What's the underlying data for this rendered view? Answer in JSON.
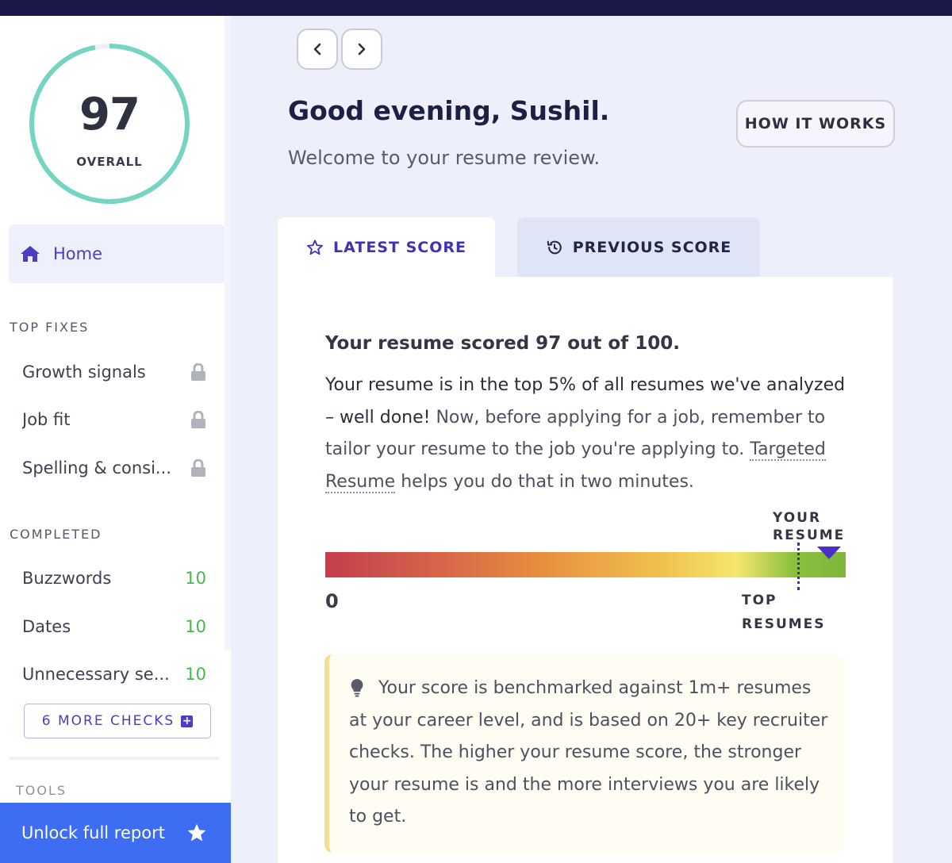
{
  "sidebar": {
    "score": {
      "value": "97",
      "label": "OVERALL",
      "fraction": 0.97,
      "ring_color": "#76d4c3"
    },
    "nav": {
      "home_label": "Home"
    },
    "top_fixes": {
      "heading": "TOP FIXES",
      "items": [
        {
          "label": "Growth signals",
          "icon": "lock-icon"
        },
        {
          "label": "Job fit",
          "icon": "lock-icon"
        },
        {
          "label": "Spelling & consi...",
          "icon": "lock-icon"
        }
      ]
    },
    "completed": {
      "heading": "COMPLETED",
      "items": [
        {
          "label": "Buzzwords",
          "score": "10"
        },
        {
          "label": "Dates",
          "score": "10"
        },
        {
          "label": "Unnecessary se...",
          "score": "10"
        }
      ]
    },
    "more_checks_label": "6 MORE CHECKS",
    "tools_heading": "TOOLS",
    "unlock_label": "Unlock full report"
  },
  "header": {
    "greeting": "Good evening, Sushil.",
    "welcome": "Welcome to your resume review.",
    "how_it_works": "HOW IT WORKS"
  },
  "tabs": [
    {
      "label": "LATEST SCORE",
      "icon": "star-outline-icon",
      "active": true
    },
    {
      "label": "PREVIOUS SCORE",
      "icon": "history-icon",
      "active": false
    }
  ],
  "result": {
    "heading": "Your resume scored 97 out of 100.",
    "para_strong": "Your resume is in the top 5% of all resumes we've analyzed – well done!",
    "para_rest": " Now, before applying for a job, remember to tailor your resume to the job you're applying to. ",
    "link_text": "Targeted Resume",
    "para_end": " helps you do that in two minutes.",
    "bar_zero": "0",
    "your_resume_label": "YOUR RESUME",
    "top_resumes_label": "TOP RESUMES",
    "marker_value": 97,
    "tip": "Your score is benchmarked against 1m+ resumes at your career level, and is based on 20+ key recruiter checks. The higher your resume score, the stronger your resume is and the more interviews you are likely to get."
  },
  "colors": {
    "brand_dark": "#1b1748",
    "accent": "#4a3fc4",
    "unlock_bg": "#3c6df2",
    "success": "#47b84a"
  }
}
